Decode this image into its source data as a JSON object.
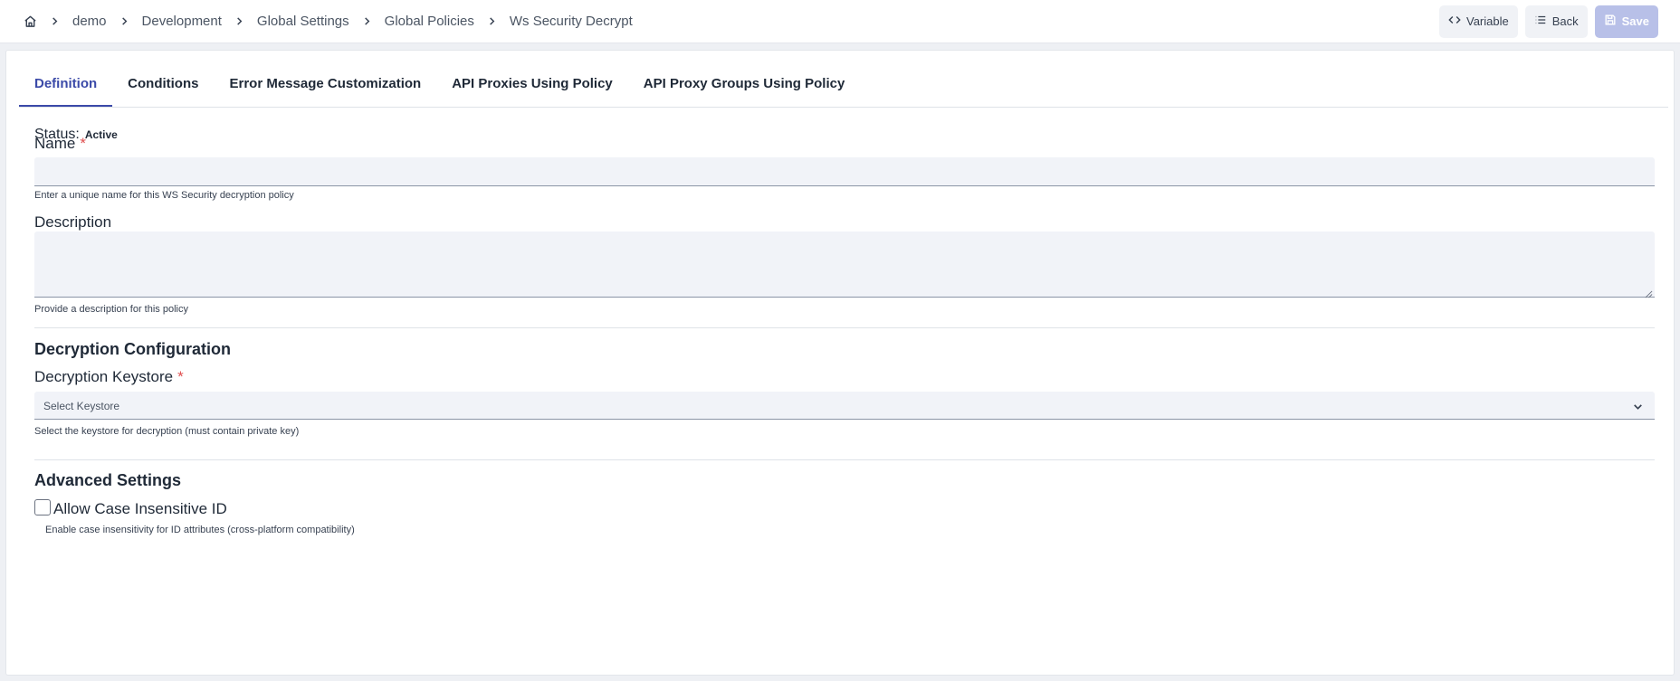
{
  "breadcrumb": {
    "home_icon": "home-icon",
    "items": [
      "demo",
      "Development",
      "Global Settings",
      "Global Policies",
      "Ws Security Decrypt"
    ]
  },
  "toolbar": {
    "variable_label": "Variable",
    "back_label": "Back",
    "save_label": "Save"
  },
  "tabs": [
    {
      "label": "Definition",
      "active": true
    },
    {
      "label": "Conditions",
      "active": false
    },
    {
      "label": "Error Message Customization",
      "active": false
    },
    {
      "label": "API Proxies Using Policy",
      "active": false
    },
    {
      "label": "API Proxy Groups Using Policy",
      "active": false
    }
  ],
  "form": {
    "status_label": "Status:",
    "status_value": "Active",
    "name_label": "Name",
    "required_mark": "*",
    "name_value": "",
    "name_help": "Enter a unique name for this WS Security decryption policy",
    "description_label": "Description",
    "description_value": "",
    "description_help": "Provide a description for this policy",
    "decryption_section": "Decryption Configuration",
    "keystore_label": "Decryption Keystore",
    "keystore_placeholder": "Select Keystore",
    "keystore_help": "Select the keystore for decryption (must contain private key)",
    "advanced_section": "Advanced Settings",
    "case_insensitive_label": "Allow Case Insensitive ID",
    "case_insensitive_checked": false,
    "case_insensitive_help": "Enable case insensitivity for ID attributes (cross-platform compatibility)"
  },
  "colors": {
    "accent": "#3b4aa8",
    "required": "#e05050",
    "field_bg": "#f1f3f8",
    "save_disabled": "#b8c0e8"
  }
}
